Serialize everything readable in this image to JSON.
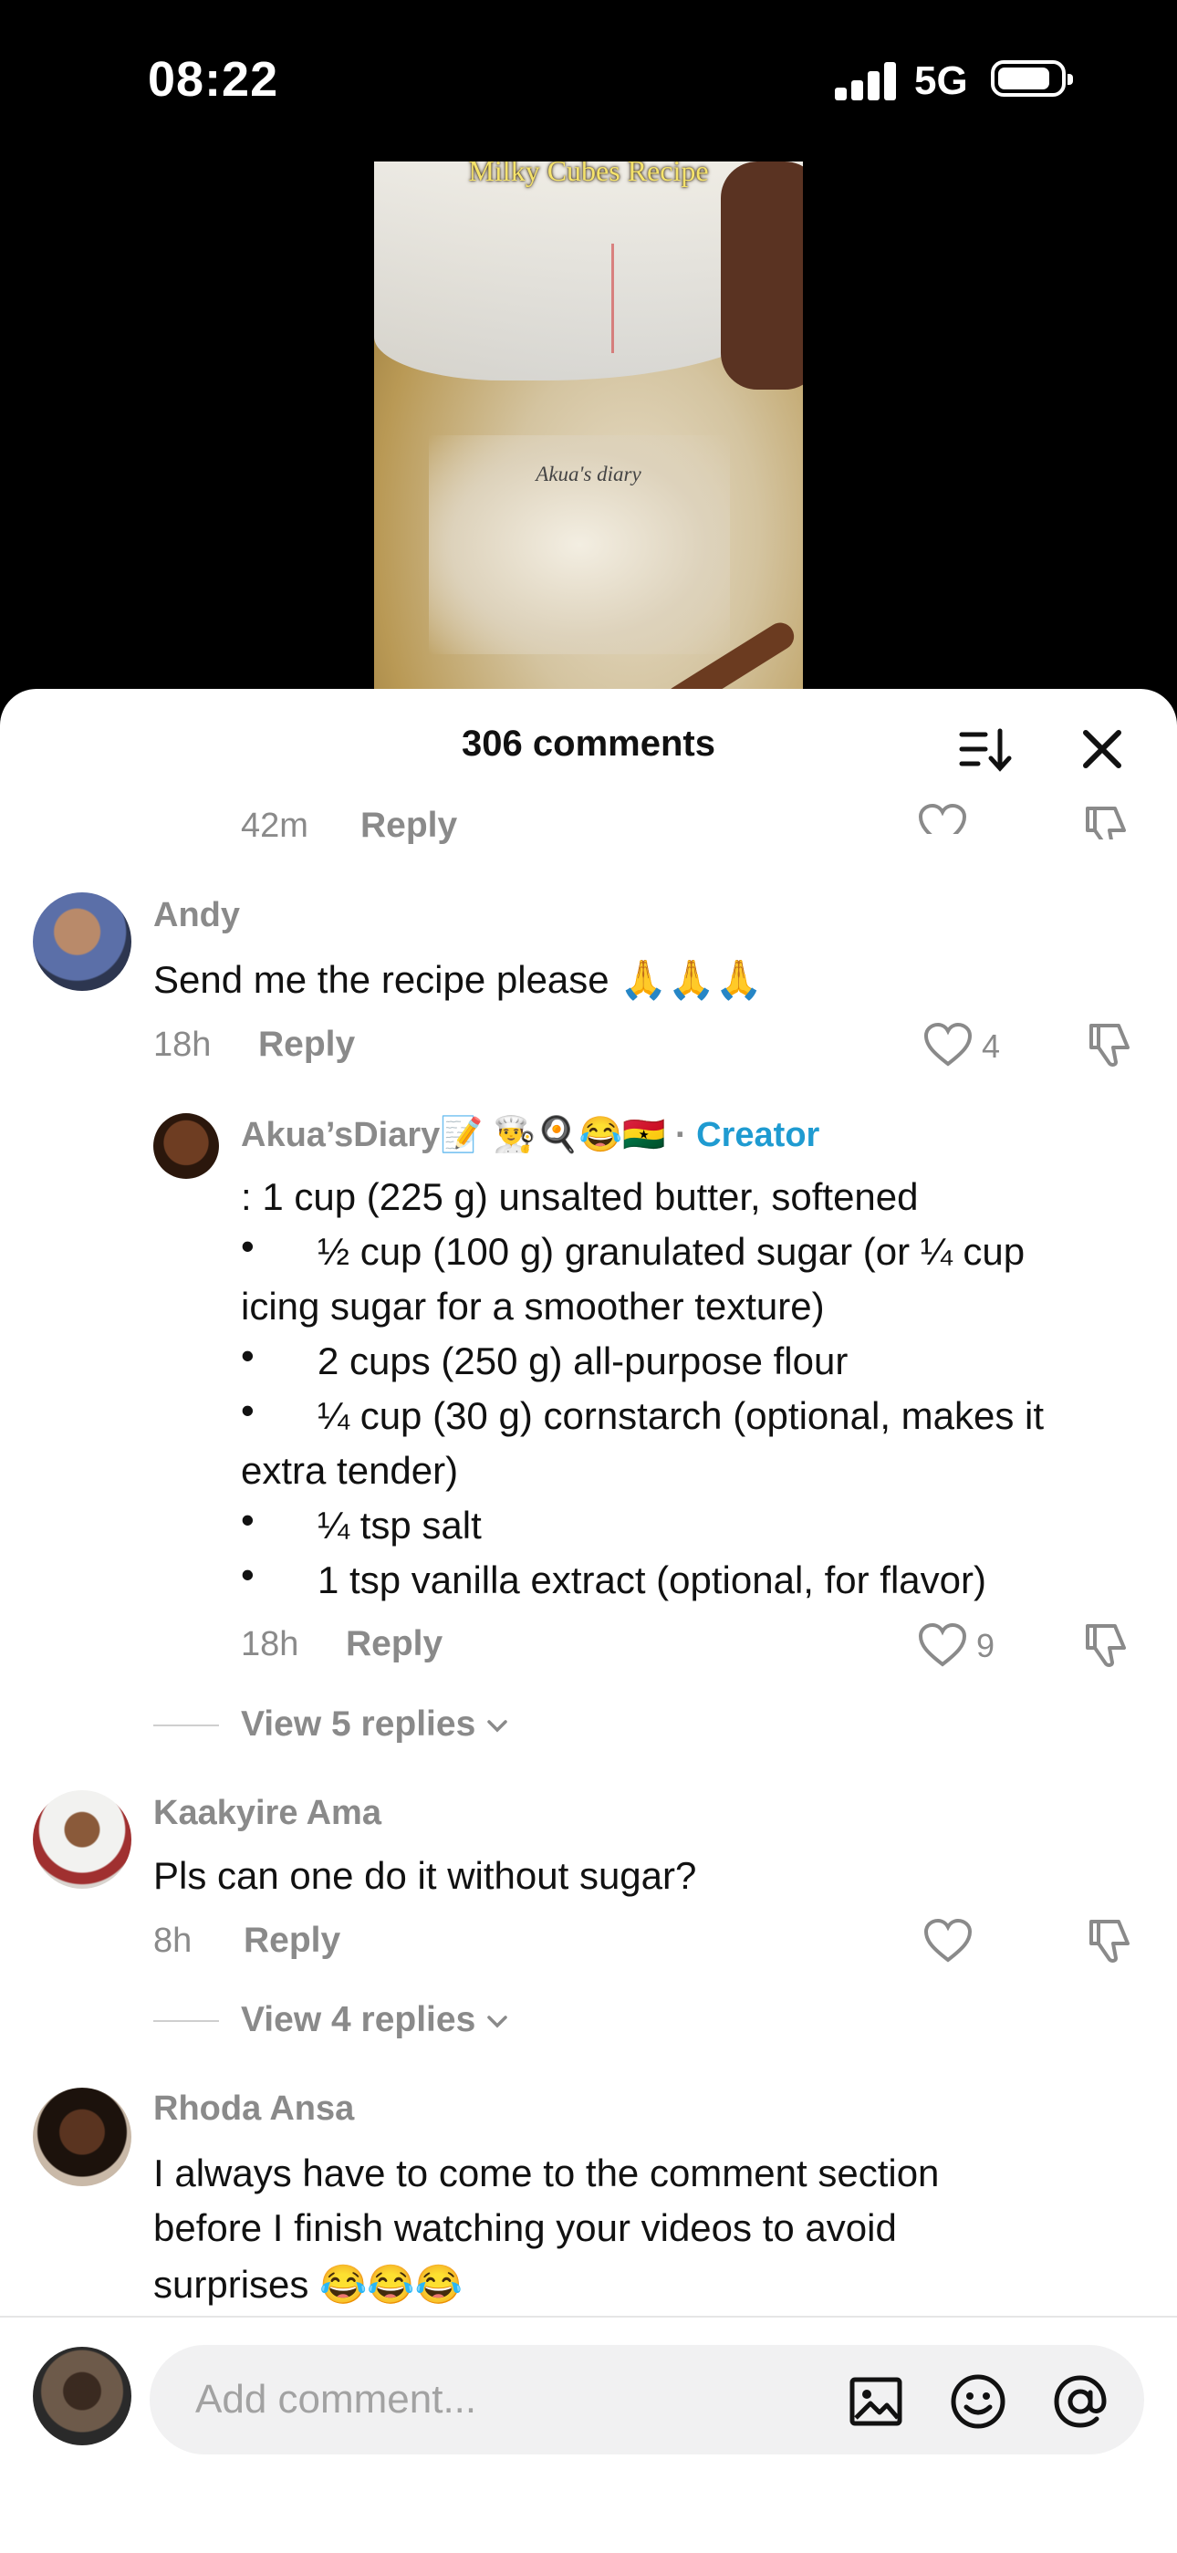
{
  "status_bar": {
    "time": "08:22",
    "network": "5G"
  },
  "video": {
    "title": "Milky Cubes Recipe",
    "watermark": "Akua's diary"
  },
  "sheet": {
    "title": "306 comments"
  },
  "top_partial": {
    "time": "42m",
    "reply_label": "Reply"
  },
  "comments": [
    {
      "username": "Andy",
      "text": "Send me the recipe please 🙏🙏🙏",
      "time": "18h",
      "reply_label": "Reply",
      "likes": "4"
    },
    {
      "username": "Akua’sDiary📝 👨‍🍳🍳😂🇬🇭",
      "badge_sep": "·",
      "badge": "Creator",
      "lines": [
        ": 1 cup (225 g) unsalted butter, softened",
        "½ cup (100 g) granulated sugar (or ¼ cup",
        "icing sugar for a smoother texture)",
        "2 cups (250 g) all-purpose flour",
        "¼ cup (30 g) cornstarch (optional, makes it",
        "extra tender)",
        "¼ tsp salt",
        "1 tsp vanilla extract (optional, for flavor)"
      ],
      "bullet": "•",
      "time": "18h",
      "reply_label": "Reply",
      "likes": "9"
    },
    {
      "username": "Kaakyire Ama",
      "text": "Pls can one do it without sugar?",
      "time": "8h",
      "reply_label": "Reply",
      "likes": ""
    },
    {
      "username": "Rhoda Ansa",
      "lines": [
        "I always have to come to the comment section",
        "before I finish watching your videos to avoid",
        "surprises 😂😂😂"
      ]
    }
  ],
  "view_replies": [
    "View 5 replies",
    "View 4 replies"
  ],
  "composer": {
    "placeholder": "Add comment..."
  },
  "icons": {
    "sort": "sort-icon",
    "close": "close-icon",
    "like": "heart-icon",
    "dislike": "thumbs-down-icon",
    "image": "image-icon",
    "emoji": "emoji-icon",
    "mention": "at-icon",
    "chevron": "chevron-down-icon"
  }
}
